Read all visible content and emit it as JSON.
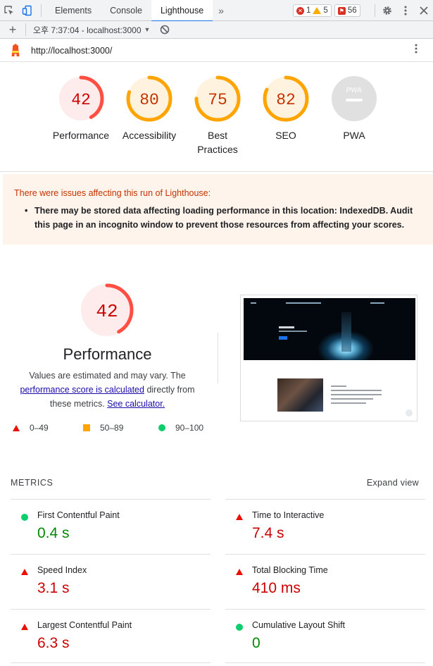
{
  "devtools": {
    "tabs": [
      {
        "label": "Elements"
      },
      {
        "label": "Console"
      },
      {
        "label": "Lighthouse"
      }
    ],
    "more_tabs": "»",
    "badges": {
      "errors": "1",
      "warnings": "5",
      "issues": "56"
    },
    "report_label": "오후 7:37:04 - localhost:3000"
  },
  "url": "http://localhost:3000/",
  "colors": {
    "fail": "#ff4e42",
    "average": "#ffa400",
    "pass": "#0cce6b"
  },
  "categories": [
    {
      "score": "42",
      "value": 0.42,
      "label": "Performance",
      "status": "fail"
    },
    {
      "score": "80",
      "value": 0.8,
      "label": "Accessibility",
      "status": "average"
    },
    {
      "score": "75",
      "value": 0.75,
      "label_lines": [
        "Best",
        "Practices"
      ],
      "status": "average"
    },
    {
      "score": "82",
      "value": 0.82,
      "label": "SEO",
      "status": "average"
    },
    {
      "badge": "PWA",
      "label": "PWA",
      "status": "na"
    }
  ],
  "warning": {
    "title": "There were issues affecting this run of Lighthouse:",
    "item": "There may be stored data affecting loading performance in this location: IndexedDB. Audit this page in an incognito window to prevent those resources from affecting your scores."
  },
  "performance": {
    "score": "42",
    "value": 0.42,
    "title": "Performance",
    "desc_1": "Values are estimated and may vary. The ",
    "desc_link1": "performance score is calculated",
    "desc_2": " directly from these metrics. ",
    "desc_link2": "See calculator."
  },
  "legend": [
    {
      "range": "0–49",
      "shape": "triangle"
    },
    {
      "range": "50–89",
      "shape": "square"
    },
    {
      "range": "90–100",
      "shape": "circle"
    }
  ],
  "metrics": {
    "heading": "METRICS",
    "expand_label": "Expand view",
    "items": [
      {
        "name": "First Contentful Paint",
        "value": "0.4 s",
        "status": "pass"
      },
      {
        "name": "Time to Interactive",
        "value": "7.4 s",
        "status": "fail"
      },
      {
        "name": "Speed Index",
        "value": "3.1 s",
        "status": "fail"
      },
      {
        "name": "Total Blocking Time",
        "value": "410 ms",
        "status": "fail"
      },
      {
        "name": "Largest Contentful Paint",
        "value": "6.3 s",
        "status": "fail"
      },
      {
        "name": "Cumulative Layout Shift",
        "value": "0",
        "status": "pass"
      }
    ]
  }
}
